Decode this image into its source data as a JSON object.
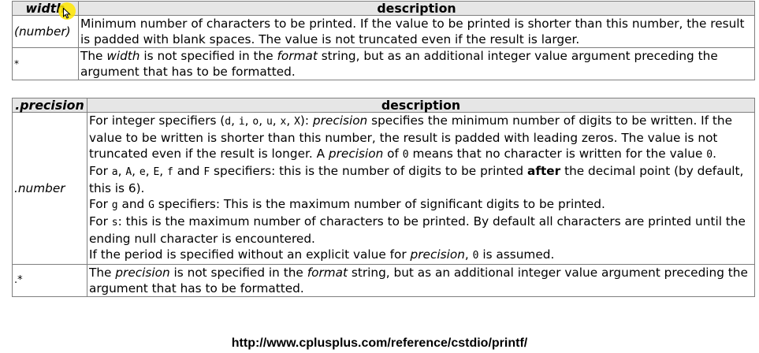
{
  "width_table": {
    "header_spec": "width",
    "header_desc": "description",
    "rows": [
      {
        "key": "(number)",
        "desc": "Minimum number of characters to be printed. If the value to be printed is shorter than this number, the result is padded with blank spaces. The value is not truncated even if the result is larger."
      },
      {
        "key": "*",
        "desc_1": "The ",
        "desc_2": "width",
        "desc_3": " is not specified in the ",
        "desc_4": "format",
        "desc_5": " string, but as an additional integer value argument preceding the argument that has to be formatted."
      }
    ]
  },
  "precision_table": {
    "header_spec": ".precision",
    "header_desc": "description",
    "number_row": {
      "key": ".number",
      "p1": {
        "a": "For integer specifiers (",
        "codes": [
          "d",
          "i",
          "o",
          "u",
          "x",
          "X"
        ],
        "b": "): ",
        "c": "precision",
        "d": " specifies the minimum number of digits to be written. If the value to be written is shorter than this number, the result is padded with leading zeros. The value is not truncated even if the result is longer. A ",
        "e": "precision",
        "f": " of ",
        "g": "0",
        "h": " means that no character is written for the value ",
        "i": "0",
        "j": "."
      },
      "p2": {
        "a": "For ",
        "codes": [
          "a",
          "A",
          "e",
          "E",
          "f",
          "F"
        ],
        "and": " and ",
        "b": " specifiers: this is the number of digits to be printed ",
        "c": "after",
        "d": " the decimal point (by default, this is 6)."
      },
      "p3": {
        "a": "For ",
        "code1": "g",
        "and": " and ",
        "code2": "G",
        "b": " specifiers: This is the maximum number of significant digits to be printed."
      },
      "p4": {
        "a": "For ",
        "code": "s",
        "b": ": this is the maximum number of characters to be printed. By default all characters are printed until the ending null character is encountered."
      },
      "p5": {
        "a": "If the period is specified without an explicit value for ",
        "b": "precision",
        "c": ", ",
        "d": "0",
        "e": " is assumed."
      }
    },
    "star_row": {
      "key": ".*",
      "a": "The ",
      "b": "precision",
      "c": " is not specified in the ",
      "d": "format",
      "e": " string, but as an additional integer value argument preceding the argument that has to be formatted."
    }
  },
  "source_url": "http://www.cplusplus.com/reference/cstdio/printf/",
  "colors": {
    "header_bg": "#e6e6e6",
    "border": "#7f7f7f",
    "cursor_highlight": "#ffe600"
  }
}
